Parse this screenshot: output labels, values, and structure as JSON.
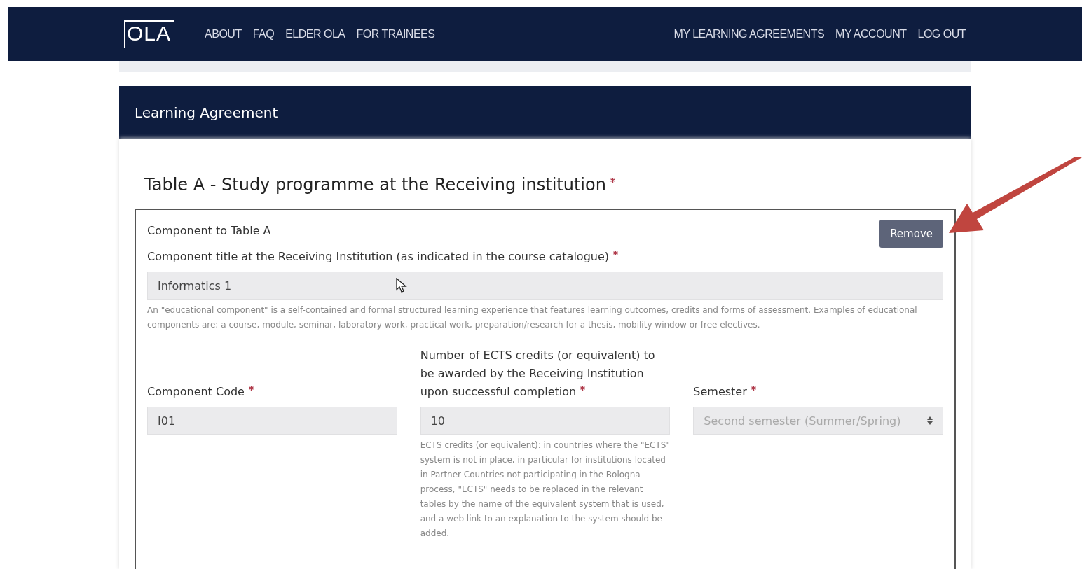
{
  "nav": {
    "logo": "OLA",
    "left_links": [
      "ABOUT",
      "FAQ",
      "ELDER OLA",
      "FOR TRAINEES"
    ],
    "right_links": [
      "MY LEARNING AGREEMENTS",
      "MY ACCOUNT",
      "LOG OUT"
    ]
  },
  "card": {
    "title": "Learning Agreement"
  },
  "section": {
    "heading": "Table A - Study programme at the Receiving institution",
    "required": true
  },
  "component": {
    "label": "Component to Table A",
    "remove_button": "Remove",
    "title_field": {
      "label": "Component title at the Receiving Institution (as indicated in the course catalogue)",
      "required": true,
      "value": "Informatics 1",
      "help": "An \"educational component\" is a self-contained and formal structured learning experience that features learning outcomes, credits and forms of assessment. Examples of educational components are: a course, module, seminar, laboratory work, practical work, preparation/research for a thesis, mobility window or free electives."
    },
    "fields": [
      {
        "kind": "input",
        "label": "Component Code",
        "required": true,
        "value": "I01"
      },
      {
        "kind": "input",
        "label": "Number of ECTS credits (or equivalent) to be awarded by the Receiving Institution upon successful completion",
        "required": true,
        "value": "10",
        "help": "ECTS credits (or equivalent): in countries where the \"ECTS\" system is not in place, in particular for institutions located in Partner Countries not participating in the Bologna process, \"ECTS\" needs to be replaced in the relevant tables by the name of the equivalent system that is used, and a web link to an explanation to the system should be added."
      },
      {
        "kind": "select",
        "label": "Semester",
        "required": true,
        "value": "Second semester (Summer/Spring)"
      }
    ]
  }
}
